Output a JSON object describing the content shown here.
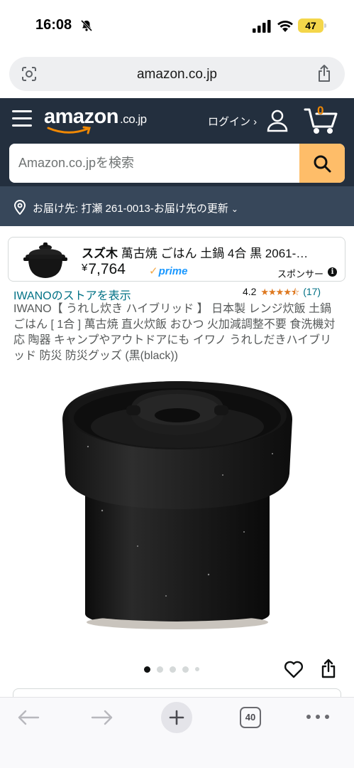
{
  "status_bar": {
    "time": "16:08",
    "battery": "47",
    "icons": [
      "bell-slash-icon",
      "signal-icon",
      "wifi-icon",
      "battery-icon"
    ]
  },
  "browser": {
    "url": "amazon.co.jp",
    "tab_count": "40"
  },
  "header": {
    "logo": "amazon",
    "logo_suffix": ".co.jp",
    "login": "ログイン ›",
    "cart_count": "0",
    "search_placeholder": "Amazon.co.jpを検索"
  },
  "delivery": {
    "text": "お届け先: 打瀬 261-0013-お届け先の更新",
    "caret": "⌄"
  },
  "sponsored": {
    "brand": "スズ木",
    "title": " 萬古焼 ごはん 土鍋 4合 黒 2061-…",
    "currency": "¥",
    "price": "7,764",
    "prime_check": "✓",
    "prime": "prime",
    "label": "スポンサー",
    "info": "i"
  },
  "product": {
    "store_link": "IWANOのストアを表示",
    "rating_value": "4.2",
    "stars": "★★★★⯪",
    "rating_count": "(17)",
    "title": "IWANO【 うれし炊き ハイブリッド 】 日本製 レンジ炊飯 土鍋ごはん [ 1合 ] 萬古焼 直火炊飯 おひつ 火加減調整不要 食洗機対応 陶器 キャンプやアウトドアにも イワノ うれしだきハイブリッド 防災 防災グッズ (黒(black))",
    "image_count": 5,
    "active_image": 1
  },
  "colors": {
    "header_bg": "#232f3e",
    "delivery_bg": "#37475a",
    "search_button": "#febd69",
    "link": "#007185",
    "star": "#de7921",
    "prime": "#1a98ff"
  }
}
